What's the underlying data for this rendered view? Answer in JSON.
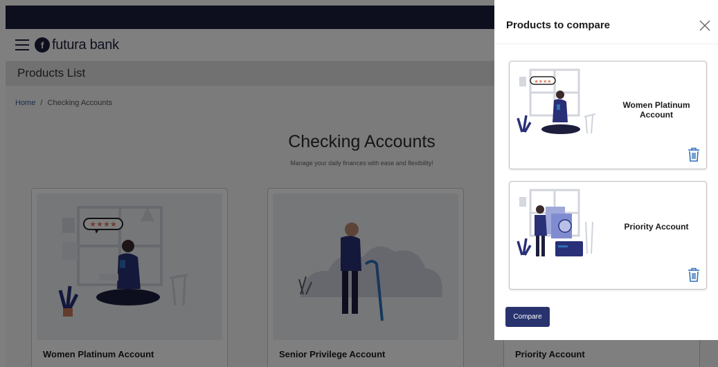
{
  "header": {
    "brand": "futura bank",
    "brand_mark": "f",
    "menu_icon": "hamburger-menu-icon"
  },
  "page": {
    "title": "Products List",
    "breadcrumb": {
      "home": "Home",
      "separator": "/",
      "current": "Checking Accounts"
    },
    "heading": "Checking Accounts",
    "subheading": "Manage your daily finances with ease and flexibility!"
  },
  "products": [
    {
      "title": "Women Platinum Account"
    },
    {
      "title": "Senior Privilege Account"
    },
    {
      "title": "Priority Account"
    }
  ],
  "compare_panel": {
    "title": "Products to compare",
    "close_icon": "close-icon",
    "items": [
      {
        "name": "Women Platinum Account",
        "remove_icon": "trash-icon"
      },
      {
        "name": "Priority Account",
        "remove_icon": "trash-icon"
      }
    ],
    "compare_label": "Compare"
  },
  "colors": {
    "topbar": "#1d1e3c",
    "primary_button": "#28326d",
    "accent_blue": "#2e6fb7",
    "illustration_navy": "#293077"
  }
}
